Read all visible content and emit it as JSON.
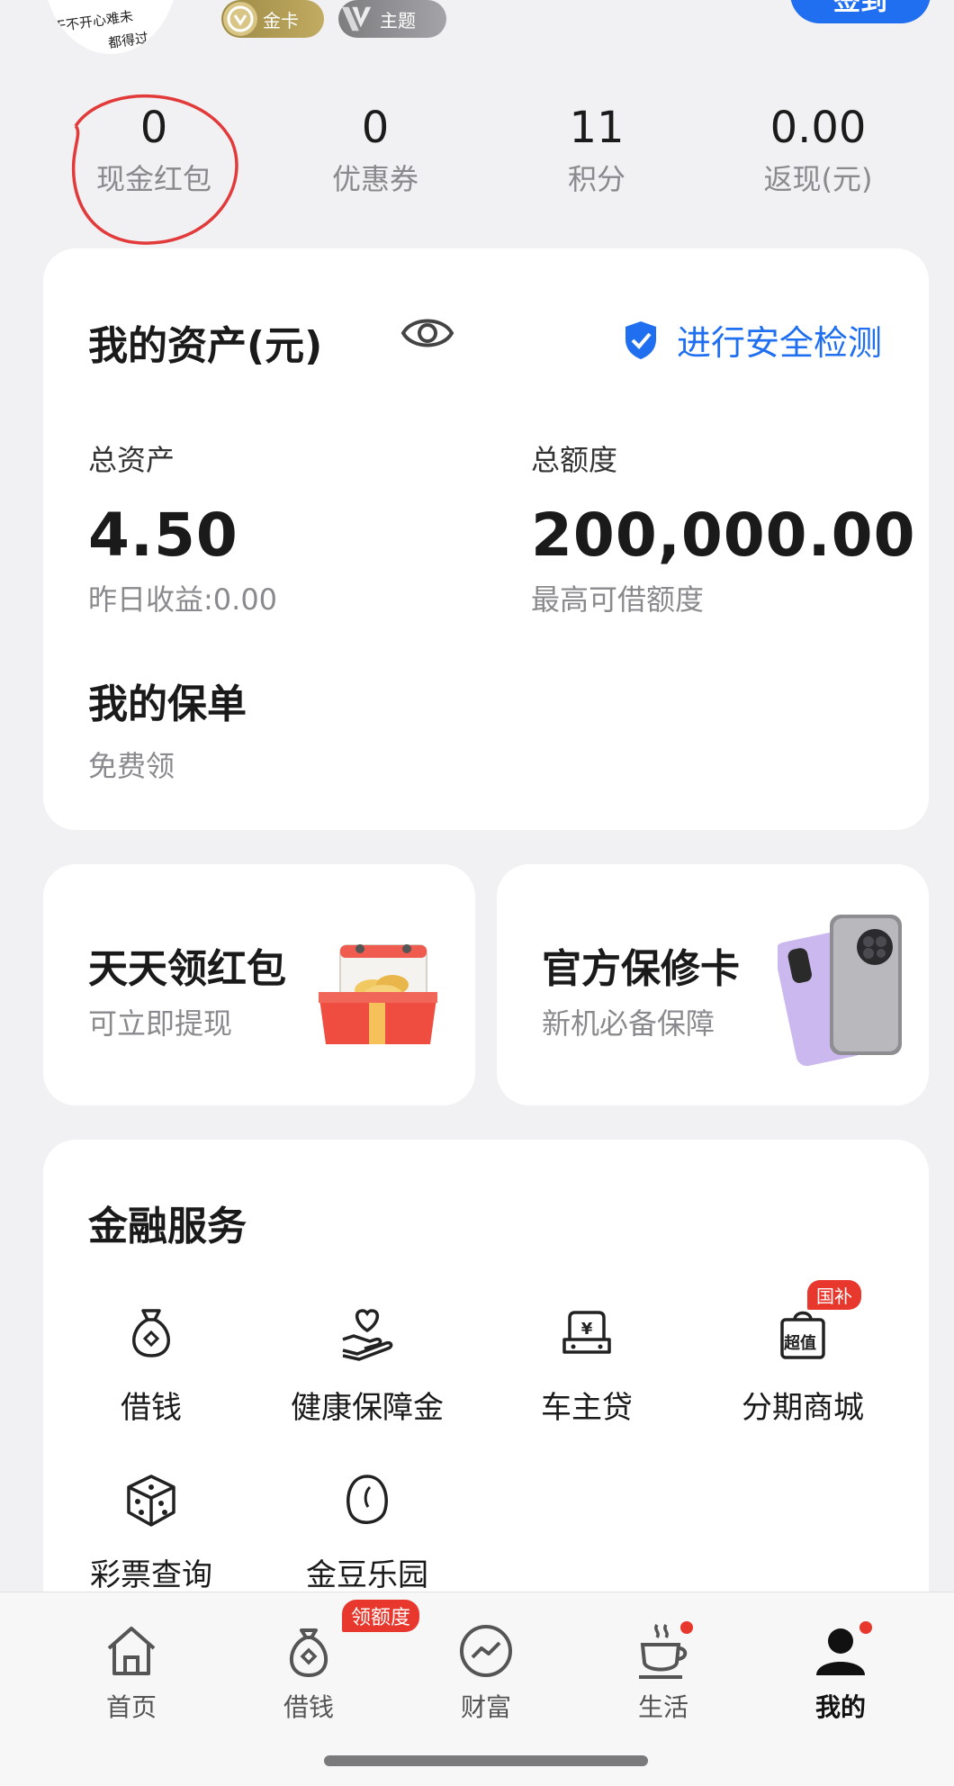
{
  "header": {
    "avatar_text_line1": "干不开心难未",
    "avatar_text_line2": "都得过",
    "badge_gold": "金卡",
    "badge_theme": "主题",
    "sign_button": "签到"
  },
  "stats": [
    {
      "value": "0",
      "label": "现金红包"
    },
    {
      "value": "0",
      "label": "优惠券"
    },
    {
      "value": "11",
      "label": "积分"
    },
    {
      "value": "0.00",
      "label": "返现(元)"
    }
  ],
  "assets": {
    "title": "我的资产(元)",
    "security_check": "进行安全检测",
    "total_assets_label": "总资产",
    "total_assets_value": "4.50",
    "yesterday_earnings": "昨日收益:0.00",
    "total_limit_label": "总额度",
    "total_limit_value": "200,000.00",
    "limit_note": "最高可借额度",
    "policy_title": "我的保单",
    "policy_sub": "免费领"
  },
  "promos": [
    {
      "title": "天天领红包",
      "subtitle": "可立即提现"
    },
    {
      "title": "官方保修卡",
      "subtitle": "新机必备保障"
    }
  ],
  "services": {
    "title": "金融服务",
    "items": [
      {
        "label": "借钱",
        "icon": "money-bag-icon"
      },
      {
        "label": "健康保障金",
        "icon": "heart-hand-icon"
      },
      {
        "label": "车主贷",
        "icon": "car-loan-icon"
      },
      {
        "label": "分期商城",
        "icon": "shopping-bag-icon",
        "tag": "国补",
        "icon_text": "超值"
      },
      {
        "label": "彩票查询",
        "icon": "dice-icon"
      },
      {
        "label": "金豆乐园",
        "icon": "bean-icon"
      }
    ]
  },
  "bottom_nav": {
    "items": [
      {
        "label": "首页",
        "icon": "home-icon"
      },
      {
        "label": "借钱",
        "icon": "money-bag-icon",
        "tag": "领额度"
      },
      {
        "label": "财富",
        "icon": "wealth-chart-icon"
      },
      {
        "label": "生活",
        "icon": "coffee-cup-icon"
      },
      {
        "label": "我的",
        "icon": "user-icon"
      }
    ],
    "active": "我的"
  },
  "colors": {
    "accent_blue": "#1f6ff0",
    "badge_red": "#e8372d",
    "background": "#f1f1f3"
  }
}
